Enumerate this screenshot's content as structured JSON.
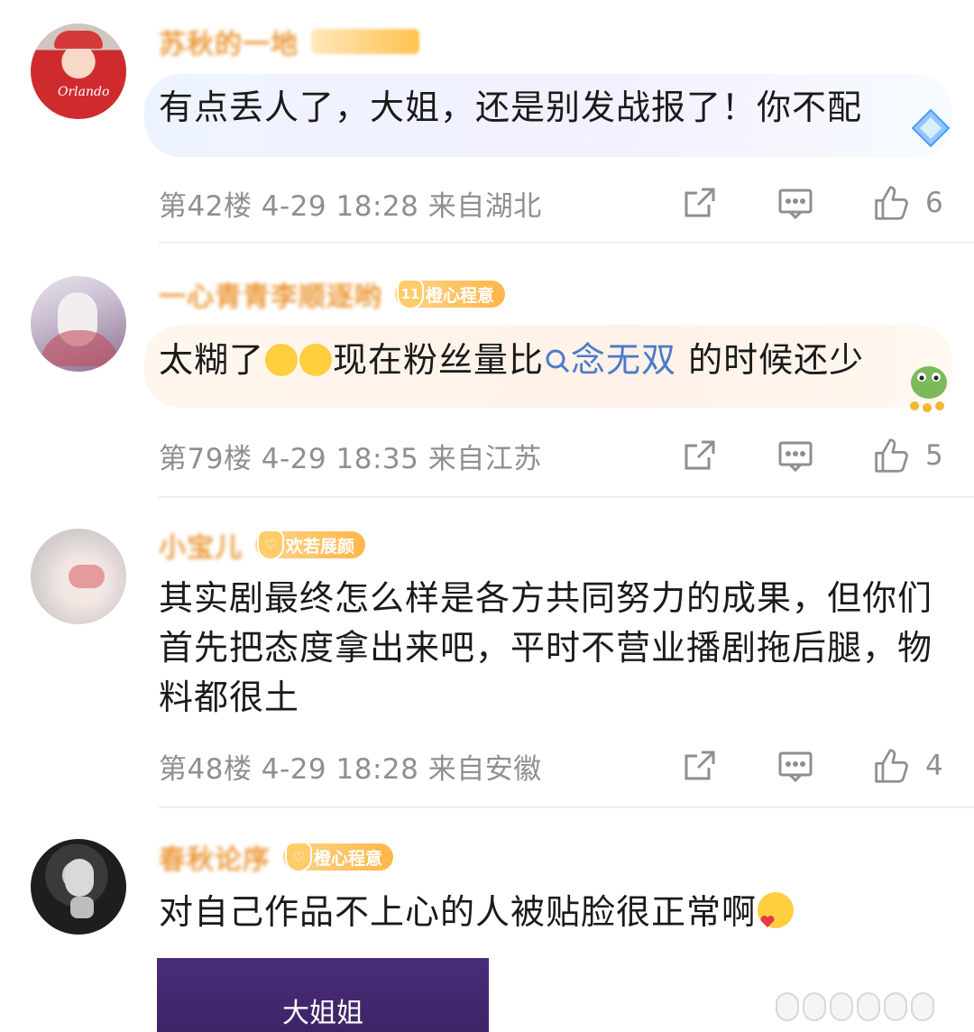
{
  "comments": [
    {
      "nickname": "苏秋的一地",
      "text": "有点丢人了，大姐，还是别发战报了！你不配",
      "floor_time": "第42楼 4-29 18:28",
      "location": "来自湖北",
      "likes": "6"
    },
    {
      "nickname": "一心青青李顺逐哟",
      "badge": "橙心程意",
      "badge_level": "11",
      "text_before": "太糊了",
      "text_mid": "现在粉丝量比",
      "topic": "念无双",
      "text_after": " 的时候还少",
      "floor_time": "第79楼 4-29 18:35",
      "location": "来自江苏",
      "likes": "5"
    },
    {
      "nickname": "小宝儿",
      "badge": "欢若展颜",
      "text": "其实剧最终怎么样是各方共同努力的成果，但你们首先把态度拿出来吧，平时不营业播剧拖后腿，物料都很土",
      "floor_time": "第48楼 4-29 18:28",
      "location": "来自安徽",
      "likes": "4"
    },
    {
      "nickname": "春秋论序",
      "badge": "橙心程意",
      "text": "对自己作品不上心的人被贴脸很正常啊"
    }
  ],
  "video_card": {
    "title": "大姐姐"
  },
  "colors": {
    "accent": "#e98a1c",
    "topic": "#4a7bc8",
    "meta": "#8f8f8f"
  }
}
